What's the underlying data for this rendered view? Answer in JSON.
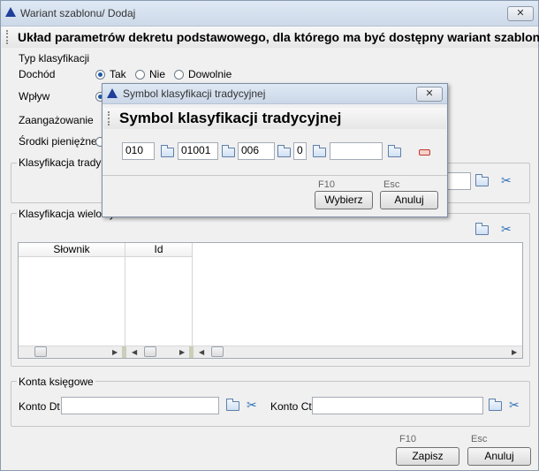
{
  "window": {
    "title": "Wariant szablonu/ Dodaj",
    "close": "✕",
    "header": "Układ parametrów dekretu podstawowego, dla którego ma być dostępny wariant szablonu"
  },
  "typ": {
    "group_label": "Typ klasyfikacji",
    "dochod_label": "Dochód",
    "opt_tak": "Tak",
    "opt_nie": "Nie",
    "opt_dowolnie": "Dowolnie",
    "wplyw_label": "Wpływ",
    "zaangazowanie_label": "Zaangażowanie",
    "srodki_label": "Środki pieniężne"
  },
  "klasyfikacja_tradycyjna": {
    "label": "Klasyfikacja tradycyjna"
  },
  "klasyfikacja_wielowymiarowa": {
    "label": "Klasyfikacja wielowymiarowa",
    "columns": [
      "Słownik",
      "Id"
    ]
  },
  "konta": {
    "group_label": "Konta księgowe",
    "dt_label": "Konto Dt",
    "ct_label": "Konto Ct"
  },
  "footer": {
    "save_hint": "F10",
    "save_label": "Zapisz",
    "cancel_hint": "Esc",
    "cancel_label": "Anuluj"
  },
  "dialog": {
    "title": "Symbol klasyfikacji tradycyjnej",
    "close": "✕",
    "header": "Symbol klasyfikacji tradycyjnej",
    "fields": [
      "010",
      "01001",
      "006",
      "0",
      ""
    ],
    "choose_hint": "F10",
    "choose_label": "Wybierz",
    "cancel_hint": "Esc",
    "cancel_label": "Anuluj"
  }
}
